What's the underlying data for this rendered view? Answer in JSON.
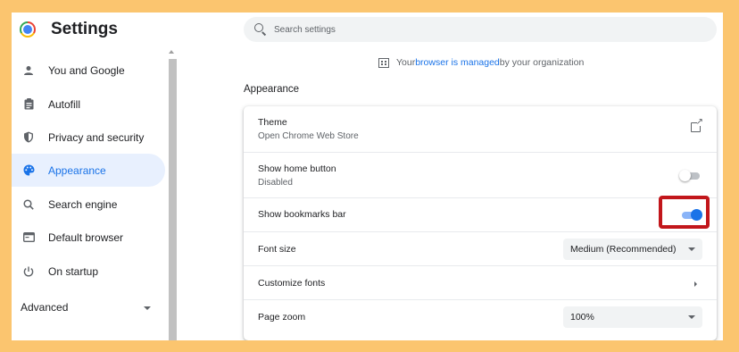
{
  "app": {
    "title": "Settings"
  },
  "search": {
    "placeholder": "Search settings"
  },
  "sidebar": {
    "items": [
      {
        "label": "You and Google",
        "icon": "person-icon"
      },
      {
        "label": "Autofill",
        "icon": "clipboard-icon"
      },
      {
        "label": "Privacy and security",
        "icon": "shield-icon"
      },
      {
        "label": "Appearance",
        "icon": "palette-icon",
        "active": true
      },
      {
        "label": "Search engine",
        "icon": "search-icon"
      },
      {
        "label": "Default browser",
        "icon": "browser-icon"
      },
      {
        "label": "On startup",
        "icon": "power-icon"
      }
    ],
    "advanced_label": "Advanced"
  },
  "managed": {
    "prefix": "Your ",
    "link": "browser is managed",
    "suffix": " by your organization"
  },
  "section": {
    "title": "Appearance"
  },
  "appearance": {
    "theme": {
      "title": "Theme",
      "subtitle": "Open Chrome Web Store"
    },
    "home_button": {
      "title": "Show home button",
      "subtitle": "Disabled",
      "enabled": false
    },
    "bookmarks_bar": {
      "title": "Show bookmarks bar",
      "enabled": true
    },
    "font_size": {
      "title": "Font size",
      "value": "Medium (Recommended)"
    },
    "customize_fonts": {
      "title": "Customize fonts"
    },
    "page_zoom": {
      "title": "Page zoom",
      "value": "100%"
    }
  },
  "colors": {
    "accent": "#1a73e8",
    "highlight": "#c2161b",
    "background": "#fbc56f"
  }
}
